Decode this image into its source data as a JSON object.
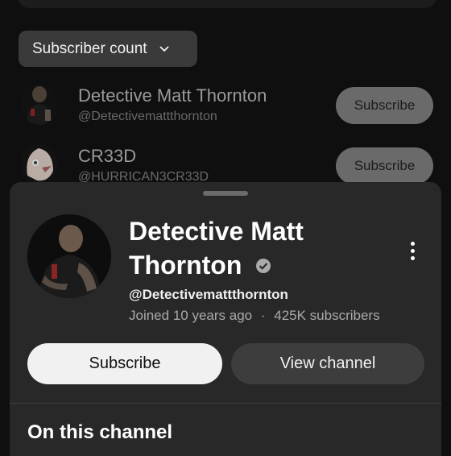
{
  "filter": {
    "label": "Subscriber count"
  },
  "results": [
    {
      "name": "Detective Matt Thornton",
      "handle": "@Detectivemattthornton",
      "button": "Subscribe"
    },
    {
      "name": "CR33D",
      "handle": "@HURRICAN3CR33D",
      "button": "Subscribe"
    }
  ],
  "sheet": {
    "title": "Detective Matt Thornton",
    "handle": "@Detectivemattthornton",
    "joined": "Joined 10 years ago",
    "separator": "·",
    "subscribers": "425K subscribers",
    "subscribe_label": "Subscribe",
    "view_channel_label": "View channel",
    "section_title": "On this channel"
  },
  "colors": {
    "background": "#0f0f0f",
    "sheet": "#282828",
    "primary_button": "#f1f1f1"
  },
  "icons": {
    "verified": "verified-check-icon",
    "more": "more-vert-icon",
    "chevron": "chevron-down-icon"
  }
}
